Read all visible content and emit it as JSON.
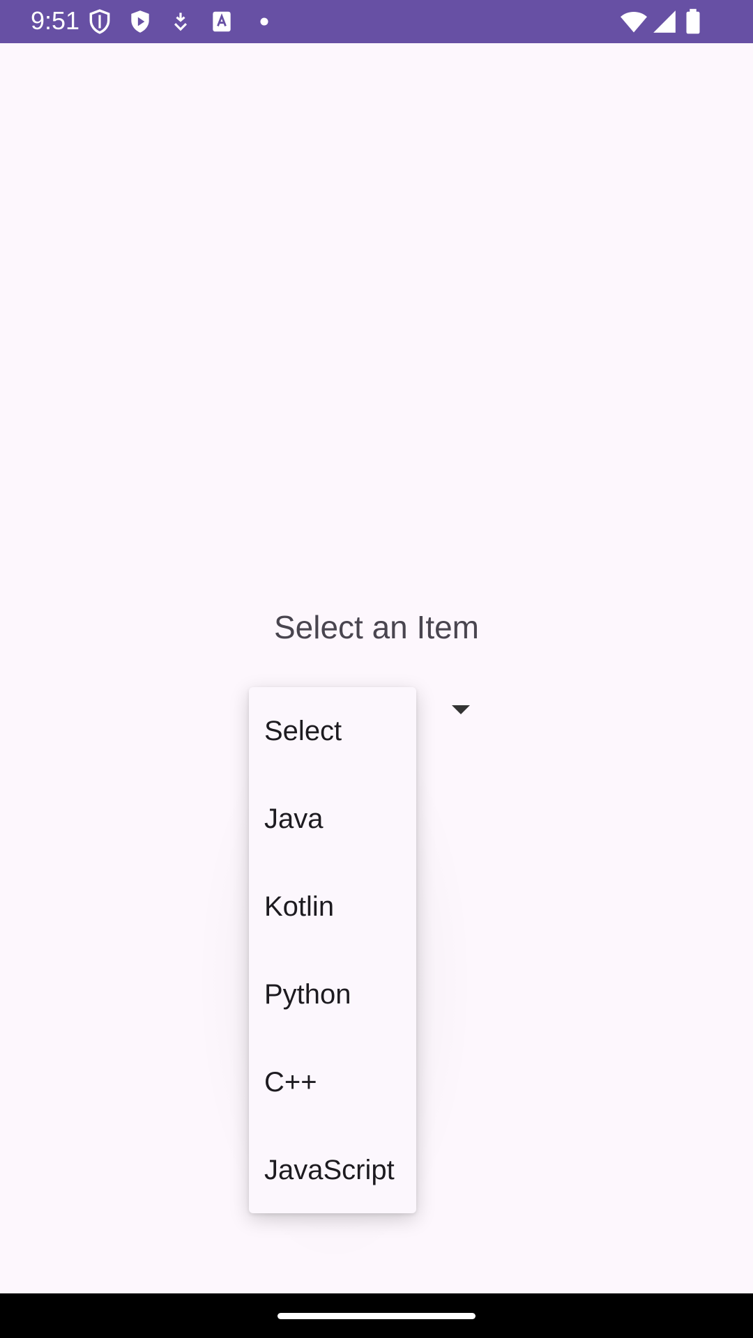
{
  "status_bar": {
    "time": "9:51",
    "background_color": "#6750a4",
    "left_icons": [
      "shield-outline-icon",
      "play-protect-icon",
      "download-icon",
      "text-a-icon",
      "dot-icon"
    ],
    "right_icons": [
      "wifi-icon",
      "cellular-signal-icon",
      "battery-icon"
    ]
  },
  "main": {
    "title": "Select an Item",
    "spinner": {
      "selected_value": "Select",
      "arrow_icon": "dropdown-arrow-icon"
    }
  },
  "dropdown": {
    "items": [
      {
        "label": "Select"
      },
      {
        "label": "Java"
      },
      {
        "label": "Kotlin"
      },
      {
        "label": "Python"
      },
      {
        "label": "C++"
      },
      {
        "label": "JavaScript"
      }
    ]
  },
  "navigation_bar": {
    "home_indicator": "home-gesture-bar"
  }
}
